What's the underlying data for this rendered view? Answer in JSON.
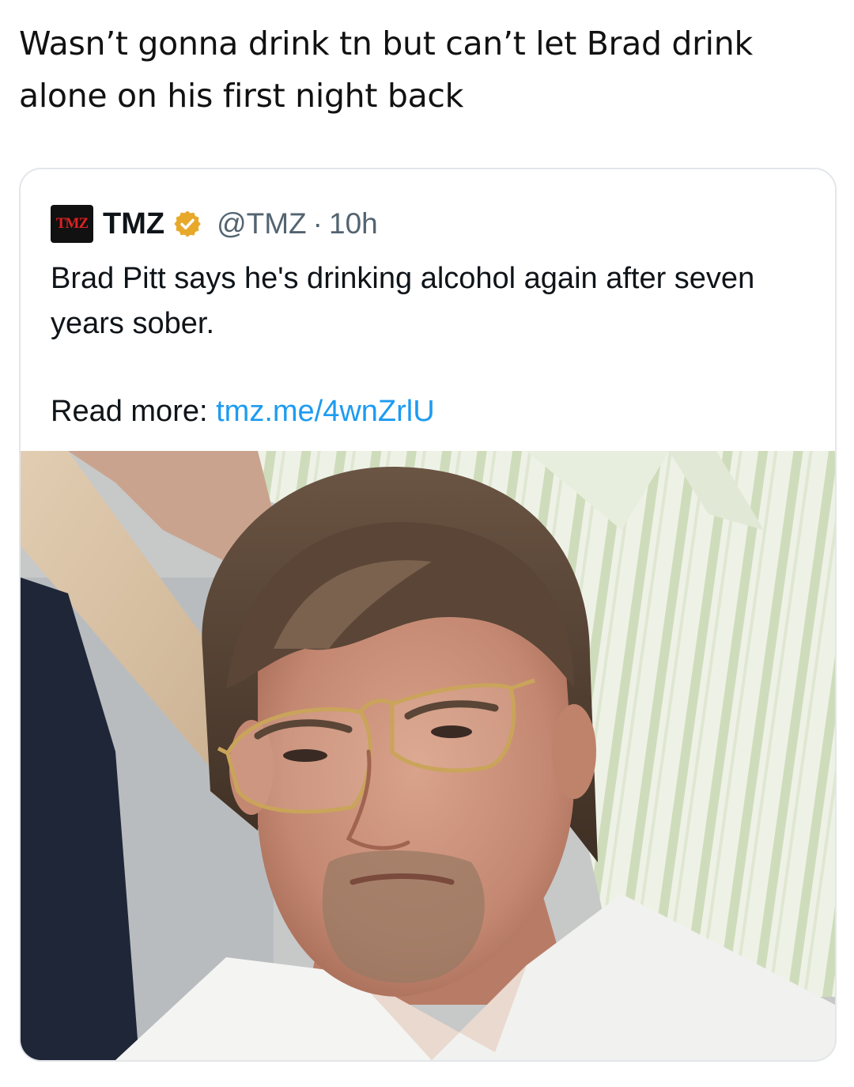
{
  "post": {
    "caption": "Wasn’t gonna drink tn but can’t let Brad drink alone on his first night back"
  },
  "quoted_tweet": {
    "avatar_text": "TMZ",
    "display_name": "TMZ",
    "verified_icon": "verified-badge-icon",
    "handle": "@TMZ",
    "separator": "·",
    "time": "10h",
    "text": "Brad Pitt says he's drinking alcohol again after seven years sober.",
    "read_more_label": "Read more:",
    "read_more_link": "tmz.me/4wnZrlU",
    "link_color": "#1d9bf0",
    "verified_color": "#e8a92b"
  }
}
